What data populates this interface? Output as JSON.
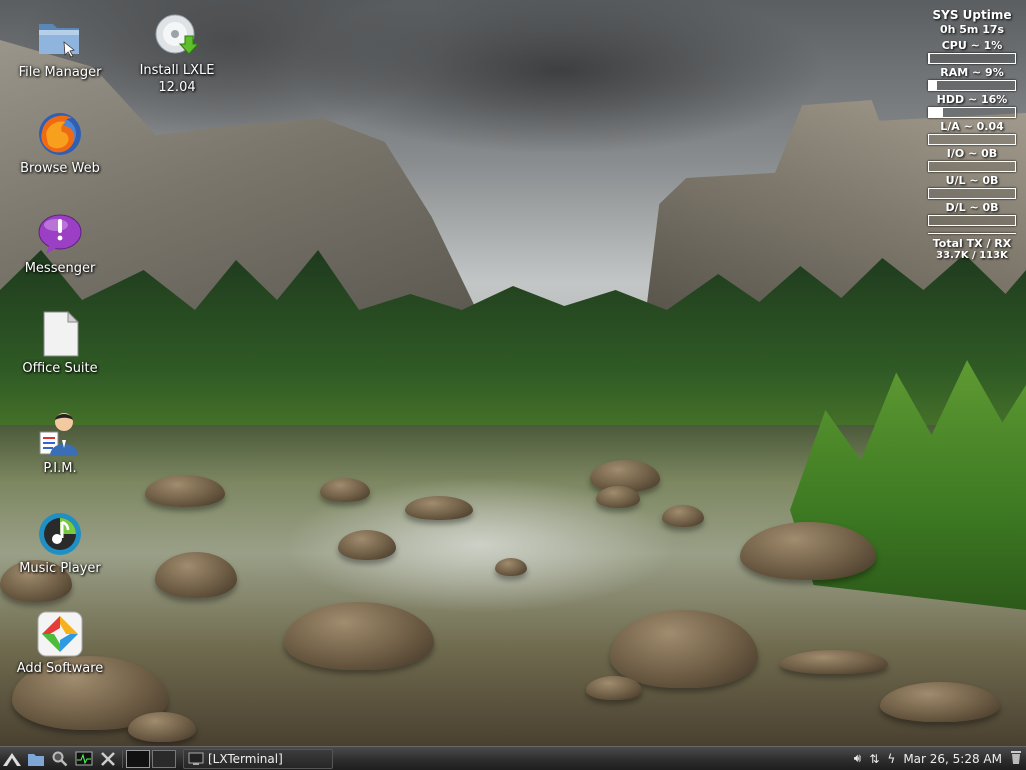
{
  "desktop_icons": [
    {
      "label": "File Manager",
      "icon": "folder-icon"
    },
    {
      "label": "Install LXLE\n12.04",
      "icon": "install-disc-icon"
    },
    {
      "label": "Browse Web",
      "icon": "firefox-icon"
    },
    {
      "label": "Messenger",
      "icon": "messenger-icon"
    },
    {
      "label": "Office Suite",
      "icon": "document-icon"
    },
    {
      "label": "P.I.M.",
      "icon": "pim-person-icon"
    },
    {
      "label": "Music Player",
      "icon": "music-player-icon"
    },
    {
      "label": "Add Software",
      "icon": "software-center-icon"
    }
  ],
  "sysmon": {
    "title": "SYS Uptime",
    "uptime": "0h 5m 17s",
    "metrics": [
      {
        "label": "CPU ~ 1%",
        "level": 0.01
      },
      {
        "label": "RAM ~ 9%",
        "level": 0.09
      },
      {
        "label": "HDD ~ 16%",
        "level": 0.16
      },
      {
        "label": "L/A ~ 0.04",
        "level": 0.0
      },
      {
        "label": "I/O ~   0B",
        "level": 0.0
      },
      {
        "label": "U/L ~   0B",
        "level": 0.0
      },
      {
        "label": "D/L ~   0B",
        "level": 0.0
      }
    ],
    "total_label": "Total TX / RX",
    "total_value": "33.7K / 113K"
  },
  "taskbar": {
    "task_label": "[LXTerminal]",
    "clock": "Mar 26,  5:28 AM"
  },
  "colors": {
    "taskbar": "#2e2e2e",
    "text": "#ffffff"
  }
}
